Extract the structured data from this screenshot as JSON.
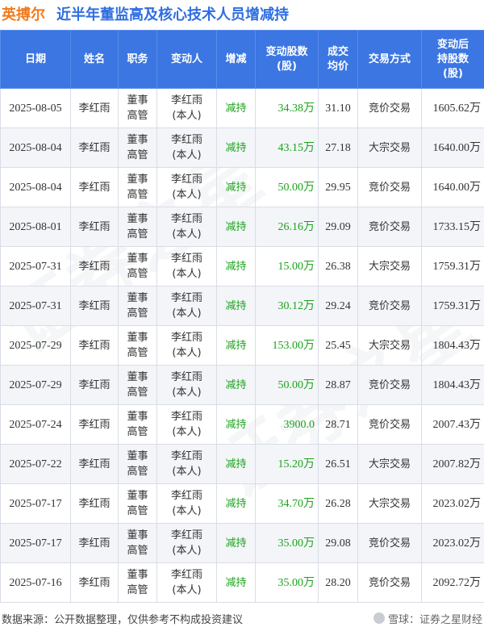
{
  "header": {
    "company": "英搏尔",
    "title": "近半年董监高及核心技术人员增减持"
  },
  "columns": [
    [
      "日期"
    ],
    [
      "姓名"
    ],
    [
      "职务"
    ],
    [
      "变动人"
    ],
    [
      "增减"
    ],
    [
      "变动股数",
      "(股)"
    ],
    [
      "成交",
      "均价"
    ],
    [
      "交易方式"
    ],
    [
      "变动后",
      "持股数",
      "(股)"
    ]
  ],
  "rows": [
    {
      "date": "2025-08-05",
      "name": "李红雨",
      "pos1": "董事",
      "pos2": "高管",
      "p1": "李红雨",
      "p2": "(本人)",
      "dir": "减持",
      "shares": "34.38万",
      "price": "31.10",
      "method": "竞价交易",
      "after": "1605.62万"
    },
    {
      "date": "2025-08-04",
      "name": "李红雨",
      "pos1": "董事",
      "pos2": "高管",
      "p1": "李红雨",
      "p2": "(本人)",
      "dir": "减持",
      "shares": "43.15万",
      "price": "27.18",
      "method": "大宗交易",
      "after": "1640.00万"
    },
    {
      "date": "2025-08-04",
      "name": "李红雨",
      "pos1": "董事",
      "pos2": "高管",
      "p1": "李红雨",
      "p2": "(本人)",
      "dir": "减持",
      "shares": "50.00万",
      "price": "29.95",
      "method": "竞价交易",
      "after": "1640.00万"
    },
    {
      "date": "2025-08-01",
      "name": "李红雨",
      "pos1": "董事",
      "pos2": "高管",
      "p1": "李红雨",
      "p2": "(本人)",
      "dir": "减持",
      "shares": "26.16万",
      "price": "29.09",
      "method": "竞价交易",
      "after": "1733.15万"
    },
    {
      "date": "2025-07-31",
      "name": "李红雨",
      "pos1": "董事",
      "pos2": "高管",
      "p1": "李红雨",
      "p2": "(本人)",
      "dir": "减持",
      "shares": "15.00万",
      "price": "26.38",
      "method": "大宗交易",
      "after": "1759.31万"
    },
    {
      "date": "2025-07-31",
      "name": "李红雨",
      "pos1": "董事",
      "pos2": "高管",
      "p1": "李红雨",
      "p2": "(本人)",
      "dir": "减持",
      "shares": "30.12万",
      "price": "29.24",
      "method": "竞价交易",
      "after": "1759.31万"
    },
    {
      "date": "2025-07-29",
      "name": "李红雨",
      "pos1": "董事",
      "pos2": "高管",
      "p1": "李红雨",
      "p2": "(本人)",
      "dir": "减持",
      "shares": "153.00万",
      "price": "25.45",
      "method": "大宗交易",
      "after": "1804.43万"
    },
    {
      "date": "2025-07-29",
      "name": "李红雨",
      "pos1": "董事",
      "pos2": "高管",
      "p1": "李红雨",
      "p2": "(本人)",
      "dir": "减持",
      "shares": "50.00万",
      "price": "28.87",
      "method": "竞价交易",
      "after": "1804.43万"
    },
    {
      "date": "2025-07-24",
      "name": "李红雨",
      "pos1": "董事",
      "pos2": "高管",
      "p1": "李红雨",
      "p2": "(本人)",
      "dir": "减持",
      "shares": "3900.0",
      "price": "28.71",
      "method": "竞价交易",
      "after": "2007.43万"
    },
    {
      "date": "2025-07-22",
      "name": "李红雨",
      "pos1": "董事",
      "pos2": "高管",
      "p1": "李红雨",
      "p2": "(本人)",
      "dir": "减持",
      "shares": "15.20万",
      "price": "26.51",
      "method": "大宗交易",
      "after": "2007.82万"
    },
    {
      "date": "2025-07-17",
      "name": "李红雨",
      "pos1": "董事",
      "pos2": "高管",
      "p1": "李红雨",
      "p2": "(本人)",
      "dir": "减持",
      "shares": "34.70万",
      "price": "26.28",
      "method": "大宗交易",
      "after": "2023.02万"
    },
    {
      "date": "2025-07-17",
      "name": "李红雨",
      "pos1": "董事",
      "pos2": "高管",
      "p1": "李红雨",
      "p2": "(本人)",
      "dir": "减持",
      "shares": "35.00万",
      "price": "29.08",
      "method": "竞价交易",
      "after": "2023.02万"
    },
    {
      "date": "2025-07-16",
      "name": "李红雨",
      "pos1": "董事",
      "pos2": "高管",
      "p1": "李红雨",
      "p2": "(本人)",
      "dir": "减持",
      "shares": "35.00万",
      "price": "28.20",
      "method": "竞价交易",
      "after": "2092.72万"
    }
  ],
  "footer": {
    "source": "数据来源：公开数据整理，仅供参考不构成投资建议",
    "brand": "雪球：证券之星财经"
  },
  "watermark": "证券之星",
  "colors": {
    "company": "#f07b1e",
    "title": "#2f6ee0",
    "header_bg": "#3b76e2",
    "decrease": "#1aa31a"
  }
}
